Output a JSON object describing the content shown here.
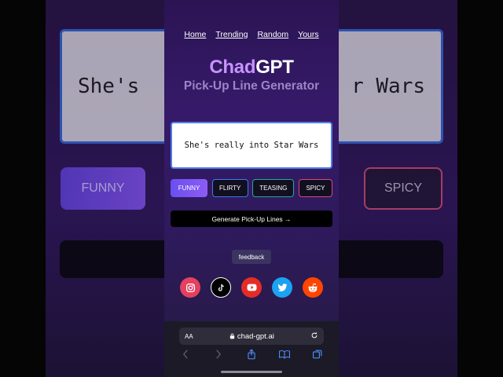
{
  "background": {
    "card_text_start": "She's",
    "card_text_end": "r Wars",
    "funny_label": "FUNNY",
    "spicy_label": "SPICY"
  },
  "nav": {
    "home": "Home",
    "trending": "Trending",
    "random": "Random",
    "yours": "Yours"
  },
  "brand": {
    "chad": "Chad",
    "gpt": "GPT",
    "subtitle": "Pick-Up Line Generator"
  },
  "input": {
    "value": "She's really into Star Wars"
  },
  "tones": {
    "funny": "FUNNY",
    "flirty": "FLIRTY",
    "teasing": "TEASING",
    "spicy": "SPICY"
  },
  "generate": {
    "label": "Generate Pick-Up Lines →"
  },
  "feedback": {
    "label": "feedback"
  },
  "socials": [
    "instagram-icon",
    "tiktok-icon",
    "youtube-icon",
    "twitter-icon",
    "reddit-icon"
  ],
  "browser": {
    "aa": "AA",
    "url": "chad-gpt.ai"
  },
  "colors": {
    "accent_purple": "#c792ff",
    "input_border": "#4f7de8",
    "flirty": "#3b7cf0",
    "teasing": "#2aa79b",
    "spicy": "#d84a79"
  }
}
